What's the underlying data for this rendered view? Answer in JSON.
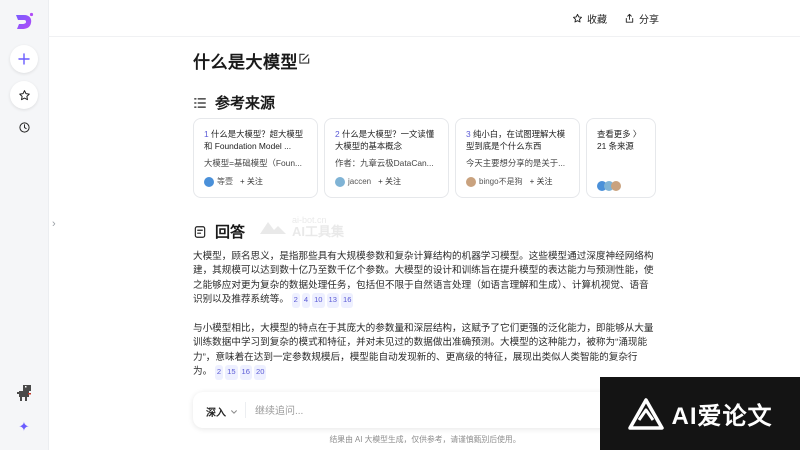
{
  "topbar": {
    "favorite_label": "收藏",
    "share_label": "分享"
  },
  "page": {
    "title": "什么是大模型"
  },
  "sources": {
    "heading": "参考来源",
    "cards": [
      {
        "num": "1",
        "title": "什么是大模型？超大模型和 Foundation Model ...",
        "snippet": "大模型=基础模型（Foun...",
        "author": "等壹",
        "follow": "+ 关注"
      },
      {
        "num": "2",
        "title": "什么是大模型？一文读懂大模型的基本概念",
        "snippet": "作者：九章云极DataCan...",
        "author": "jaccen",
        "follow": "+ 关注"
      },
      {
        "num": "3",
        "title": "纯小白，在试图理解大模型到底是个什么东西",
        "snippet": "今天主要想分享的是关于...",
        "author": "bingo不是狗",
        "follow": "+ 关注"
      }
    ],
    "more_label": "查看更多 〉",
    "more_count": "21 条来源"
  },
  "answer": {
    "heading": "回答",
    "paragraph1": "大模型，顾名思义，是指那些具有大规模参数和复杂计算结构的机器学习模型。这些模型通过深度神经网络构建，其规模可以达到数十亿乃至数千亿个参数。大模型的设计和训练旨在提升模型的表达能力与预测性能，使之能够应对更为复杂的数据处理任务，包括但不限于自然语言处理（如语言理解和生成）、计算机视觉、语音识别以及推荐系统等。",
    "refs1": [
      "2",
      "4",
      "10",
      "13",
      "16"
    ],
    "paragraph2": "与小模型相比，大模型的特点在于其庞大的参数量和深层结构，这赋予了它们更强的泛化能力，即能够从大量训练数据中学习到复杂的模式和特征，并对未见过的数据做出准确预测。大模型的这种能力，被称为“涌现能力”，意味着在达到一定参数规模后，模型能自动发现新的、更高级的特征，展现出类似人类智能的复杂行为。",
    "refs2": [
      "2",
      "15",
      "16",
      "20"
    ]
  },
  "watermark": {
    "site": "ai-bot.cn",
    "name": "AI工具集"
  },
  "input": {
    "mode_label": "深入",
    "placeholder": "继续追问..."
  },
  "footer": {
    "disclaimer": "结果由 AI 大模型生成，仅供参考，请谨慎甄别后使用。"
  },
  "brand": {
    "text": "AI爱论文"
  },
  "colors": {
    "accent": "#5b5bd6",
    "brand_bg": "#141414"
  }
}
